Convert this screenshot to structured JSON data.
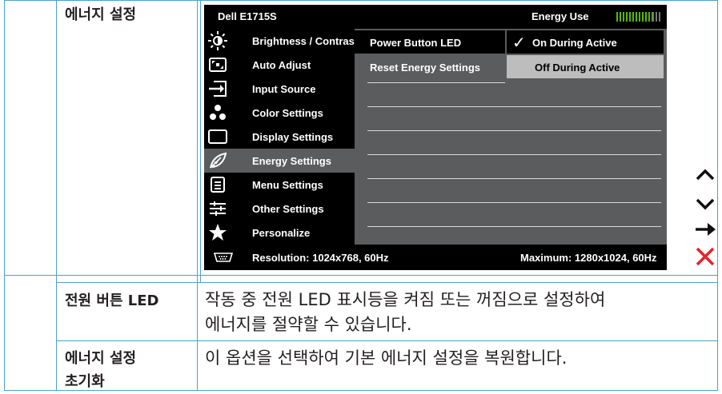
{
  "table": {
    "rows": [
      {
        "label": "에너지 설정",
        "description": ""
      },
      {
        "label": "전원 버튼 LED",
        "description_lines": [
          "작동 중 전원 LED 표시등을 켜짐 또는 꺼짐으로 설정하여",
          "에너지를 절약할 수 있습니다."
        ]
      },
      {
        "label_lines": [
          "에너지 설정",
          "초기화"
        ],
        "description": "이 옵션을 선택하여 기본 에너지 설정을 복원합니다."
      }
    ]
  },
  "osd": {
    "model": "Dell E1715S",
    "energy_use_label": "Energy Use",
    "energy_use_level_fraction": 0.8,
    "menu": [
      {
        "label": "Brightness / Contrast",
        "icon": "brightness-icon"
      },
      {
        "label": "Auto Adjust",
        "icon": "auto-adjust-icon"
      },
      {
        "label": "Input Source",
        "icon": "input-source-icon"
      },
      {
        "label": "Color Settings",
        "icon": "color-settings-icon"
      },
      {
        "label": "Display Settings",
        "icon": "display-settings-icon"
      },
      {
        "label": "Energy Settings",
        "icon": "energy-leaf-icon",
        "selected": true
      },
      {
        "label": "Menu Settings",
        "icon": "menu-settings-icon"
      },
      {
        "label": "Other Settings",
        "icon": "other-settings-icon"
      },
      {
        "label": "Personalize",
        "icon": "star-icon"
      }
    ],
    "submenu": [
      {
        "label": "Power Button LED",
        "options": [
          {
            "label": "On During Active",
            "checked": true
          }
        ]
      },
      {
        "label": "Reset Energy Settings",
        "options": [
          {
            "label": "Off During Active",
            "checked": false
          }
        ]
      }
    ],
    "footer": {
      "resolution": "Resolution: 1024x768, 60Hz",
      "maximum": "Maximum: 1280x1024, 60Hz",
      "icon": "vga-connector-icon"
    },
    "colors": {
      "background": "#000000",
      "panel": "#5b5c5e",
      "energy_bar": "#59b800",
      "table_border": "#4aa3cc"
    }
  },
  "side_buttons": [
    {
      "name": "up-arrow-icon"
    },
    {
      "name": "down-arrow-icon"
    },
    {
      "name": "right-arrow-icon"
    },
    {
      "name": "close-icon",
      "color": "#e8232a"
    }
  ]
}
